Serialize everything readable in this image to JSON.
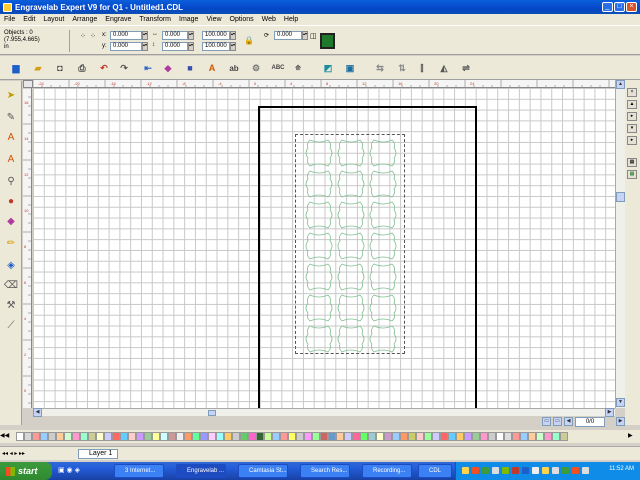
{
  "window": {
    "title": "Engravelab Expert V9 for Q1 - Untitled1.CDL"
  },
  "menu": [
    "File",
    "Edit",
    "Layout",
    "Arrange",
    "Engrave",
    "Transform",
    "Image",
    "View",
    "Options",
    "Web",
    "Help"
  ],
  "propbar": {
    "objects_label": "Objects : 0",
    "coords": "(7.955,4.665)",
    "unit": "in",
    "x": "0.000",
    "y": "0.000",
    "w": "0.000",
    "h": "0.000",
    "scale_x": "100.000",
    "scale_y": "100.000",
    "rotation": "0.000",
    "fill_color": "#1e7a2a"
  },
  "ruler": {
    "h_labels": [
      "-24",
      "-20",
      "-16",
      "-12",
      "-8",
      "-4",
      "0",
      "4",
      "8",
      "12",
      "16",
      "20",
      "24"
    ],
    "v_labels": [
      "16",
      "14",
      "12",
      "10",
      "8",
      "6",
      "4",
      "2",
      "0"
    ]
  },
  "page_nav": {
    "current": "0/0"
  },
  "layer": {
    "name": "Layer 1"
  },
  "taskbar": {
    "start": "start",
    "tasks": [
      "3 Internet...",
      "Engravelab ...",
      "Camtasia St...",
      "Search Res...",
      "Recording...",
      "CDL"
    ],
    "clock": "11:52 AM"
  },
  "colors": {
    "shape_stroke": "#7fbf8f",
    "title_bar": "#0a5fdc",
    "accent_green": "#1e7a2a"
  }
}
